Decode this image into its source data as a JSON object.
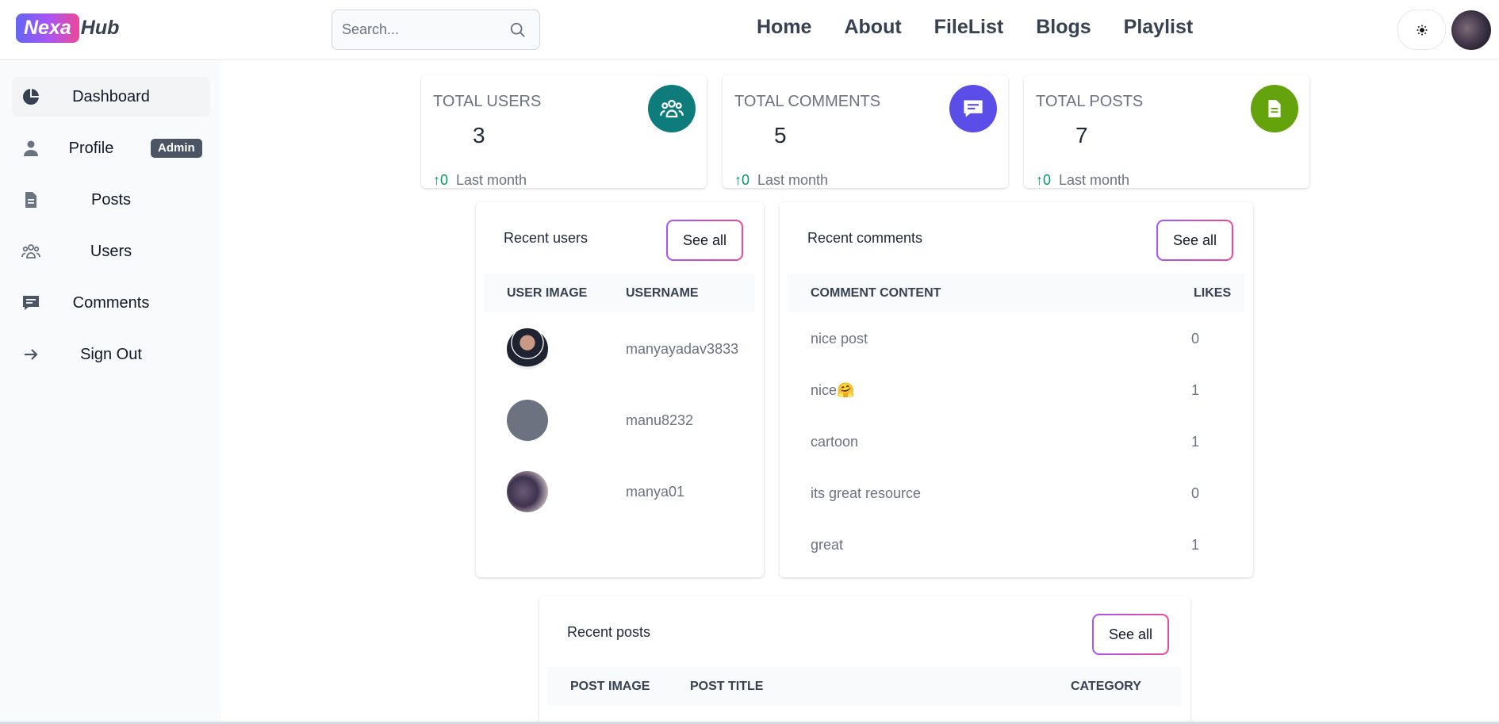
{
  "header": {
    "logo_badge": "Nexa",
    "logo_rest": "Hub",
    "search_placeholder": "Search...",
    "nav": [
      "Home",
      "About",
      "FileList",
      "Blogs",
      "Playlist"
    ],
    "theme_icon": "sun-icon"
  },
  "sidebar": {
    "items": [
      {
        "label": "Dashboard",
        "icon": "pie-chart-icon",
        "active": true
      },
      {
        "label": "Profile",
        "icon": "user-icon",
        "badge": "Admin"
      },
      {
        "label": "Posts",
        "icon": "document-icon"
      },
      {
        "label": "Users",
        "icon": "users-icon"
      },
      {
        "label": "Comments",
        "icon": "comment-icon"
      },
      {
        "label": "Sign Out",
        "icon": "arrow-right-icon"
      }
    ]
  },
  "stats": [
    {
      "title": "Total Users",
      "value": "3",
      "change": "0",
      "period": "Last month",
      "color": "#0e7c7b",
      "icon": "users-icon"
    },
    {
      "title": "Total Comments",
      "value": "5",
      "change": "0",
      "period": "Last month",
      "color": "#5b4ee8",
      "icon": "comment-icon"
    },
    {
      "title": "Total Posts",
      "value": "7",
      "change": "0",
      "period": "Last month",
      "color": "#65a30d",
      "icon": "document-icon"
    }
  ],
  "recent_users": {
    "title": "Recent users",
    "see_all": "See all",
    "headers": [
      "User image",
      "Username"
    ],
    "rows": [
      {
        "username": "manyayadav3833"
      },
      {
        "username": "manu8232"
      },
      {
        "username": "manya01"
      }
    ]
  },
  "recent_comments": {
    "title": "Recent comments",
    "see_all": "See all",
    "headers": [
      "Comment content",
      "Likes"
    ],
    "rows": [
      {
        "content": "nice post",
        "likes": "0"
      },
      {
        "content": "nice🤗",
        "likes": "1"
      },
      {
        "content": "cartoon",
        "likes": "1"
      },
      {
        "content": "its great resource",
        "likes": "0"
      },
      {
        "content": "great",
        "likes": "1"
      }
    ]
  },
  "recent_posts": {
    "title": "Recent posts",
    "see_all": "See all",
    "headers": [
      "Post image",
      "Post title",
      "Category"
    ]
  },
  "colors": {
    "accent_from": "#a855f7",
    "accent_to": "#ec4899"
  }
}
